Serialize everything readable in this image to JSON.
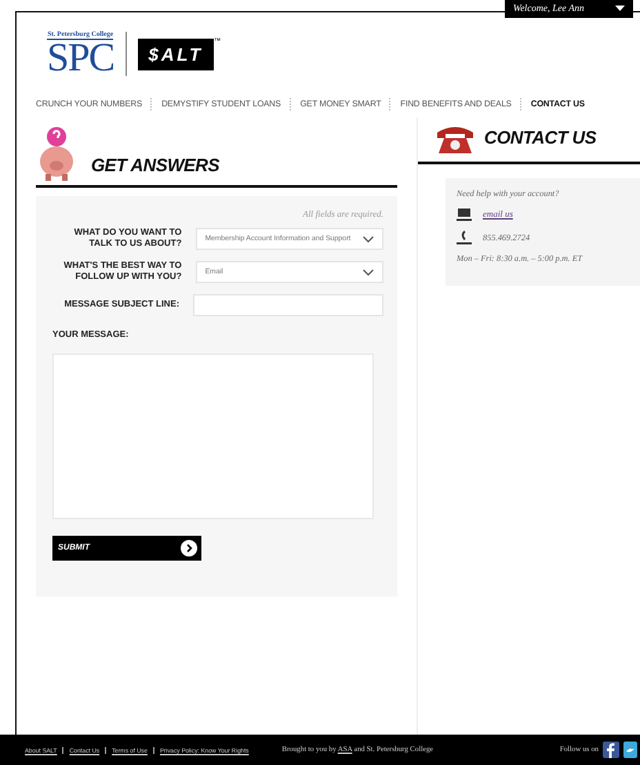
{
  "welcome": {
    "label": "Welcome, Lee Ann"
  },
  "logo": {
    "college": "St. Petersburg College",
    "mark": "SPC",
    "brand": "$ALT",
    "trademark": "™"
  },
  "nav": [
    {
      "label": "CRUNCH YOUR NUMBERS",
      "selected": false
    },
    {
      "label": "DEMYSTIFY STUDENT LOANS",
      "selected": false
    },
    {
      "label": "GET MONEY SMART",
      "selected": false
    },
    {
      "label": "FIND BENEFITS AND DEALS",
      "selected": false
    },
    {
      "label": "CONTACT US",
      "selected": true
    }
  ],
  "form": {
    "title": "GET ANSWERS",
    "note": "All fields are required.",
    "fields": [
      {
        "kind": "select",
        "label": "WHAT DO YOU WANT TO TALK TO US ABOUT?",
        "value": "Membership Account Information and Support"
      },
      {
        "kind": "select",
        "label": "WHAT'S THE BEST WAY TO FOLLOW UP WITH YOU?",
        "value": "Email"
      },
      {
        "kind": "text",
        "label": "MESSAGE SUBJECT LINE:"
      },
      {
        "kind": "textarea",
        "label": "YOUR MESSAGE:"
      }
    ],
    "submit": "SUBMIT"
  },
  "contact": {
    "title": "CONTACT US",
    "intro": "Need help with your account?",
    "email": "email us",
    "phone": "855.469.2724",
    "hours": "Mon – Fri: 8:30 a.m. – 5:00 p.m. ET"
  },
  "footer": {
    "links": [
      "About SALT",
      "Contact Us",
      "Terms of Use",
      "Privacy Policy: Know Your Rights"
    ],
    "credit_before": "Brought to you by",
    "credit_link": "ASA",
    "credit_after": "and St. Petersburg College",
    "follow": "Follow us on"
  }
}
